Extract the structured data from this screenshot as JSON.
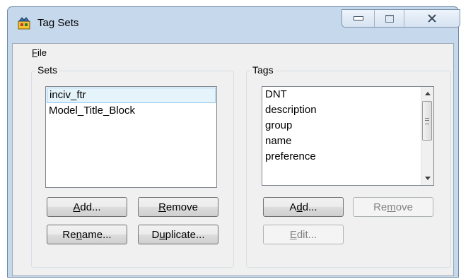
{
  "window": {
    "title": "Tag Sets",
    "icon": "tag-sets-app-icon",
    "controls": {
      "minimize": "minimize-icon",
      "maximize": "maximize-icon",
      "close": "close-icon"
    }
  },
  "menu": {
    "file_pre": "",
    "file_u": "F",
    "file_post": "ile"
  },
  "sets": {
    "legend": "Sets",
    "items": [
      "inciv_ftr",
      "Model_Title_Block"
    ],
    "selected_index": 0,
    "buttons": {
      "add": {
        "pre": "",
        "u": "A",
        "post": "dd..."
      },
      "remove": {
        "pre": "",
        "u": "R",
        "post": "emove"
      },
      "rename": {
        "pre": "Re",
        "u": "n",
        "post": "ame..."
      },
      "duplicate": {
        "pre": "D",
        "u": "u",
        "post": "plicate..."
      }
    }
  },
  "tags": {
    "legend": "Tags",
    "items": [
      "DNT",
      "description",
      "group",
      "name",
      "preference"
    ],
    "buttons": {
      "add": {
        "pre": "A",
        "u": "d",
        "post": "d..."
      },
      "remove": {
        "pre": "Re",
        "u": "m",
        "post": "ove"
      },
      "edit": {
        "pre": "",
        "u": "E",
        "post": "dit..."
      }
    }
  },
  "colors": {
    "title_bg": "#c6d8ec",
    "selection_bg": "#e5f3fb",
    "selection_border": "#97c8ec"
  }
}
